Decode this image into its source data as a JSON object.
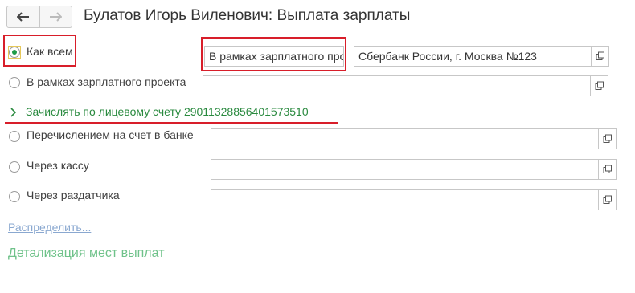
{
  "header": {
    "title": "Булатов Игорь Виленович: Выплата зарплаты",
    "back_icon": "arrow-left-icon",
    "forward_icon": "arrow-right-icon"
  },
  "options": [
    {
      "label": "Как всем",
      "selected": true
    },
    {
      "label": "В рамках зарплатного проекта",
      "selected": false
    },
    {
      "label": "Перечислением на счет в банке",
      "selected": false
    },
    {
      "label": "Через кассу",
      "selected": false
    },
    {
      "label": "Через раздатчика",
      "selected": false
    }
  ],
  "fields": {
    "how_all_value": "В рамках зарплатного проекта",
    "how_all_bank": "Сбербанк России, г. Москва №123"
  },
  "account_link": "Зачислять по лицевому счету 29011328856401573510",
  "distribute_link": "Распределить...",
  "details_link": "Детализация мест выплат",
  "colors": {
    "highlight": "#d81e2a",
    "accent_green": "#2a8a3f",
    "link_blue": "#8aa8d0"
  }
}
